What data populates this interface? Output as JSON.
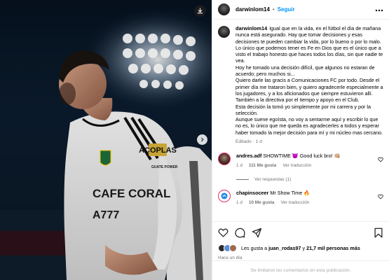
{
  "media": {
    "download_icon": "download-icon",
    "next_icon": "chevron-right-icon",
    "jersey": {
      "sponsor_top": "ACOPLAS",
      "sponsor_mid": "CAFE CORAL",
      "sponsor_low": "A777",
      "sleeve": "GUATE POWER"
    }
  },
  "header": {
    "username": "darwinlom14",
    "separator": "•",
    "follow_label": "Seguir",
    "more_icon": "more-horizontal-icon"
  },
  "caption": {
    "username": "darwinlom14",
    "text": "Igual que en la vida, en el fútbol el día de mañana nunca está asegurado. Hay que tomar decisiones y esas decisiones te pueden cambiar la vida, por lo bueno o por lo malo. Lo único que podemos tener es Fe en Dios que es el único que a visto el trabajo honesto que haces todos los días, sin que nadie te vea.\nHoy he tomado una decisión difícil, que algunos no estaran de acuerdo; pero muchos si...\nQuiero darle las gracis a Comunicaciones FC por todo. Desde el primer día me trataron bien, y quiero agradecerle especialmente a los jugadores, y a los aficionados que siempre estuvieron allí. También a la directiva por el tiempo y apoyo en el Club.\nEsta decisión la tomó yo simplemente por mi carrera y por la selección.\nAunque suene egoísta, no voy a sentarme aquí y escribir lo que no es, lo único que me queda es agradecerles a todos y esperar haber tomado la mejor decisión para mí y mi núcleo mas cercano.",
    "edited": "Editado · 1 d"
  },
  "comments": [
    {
      "username": "andres.adf",
      "text": "SHOWTIME 😈 Good luck bro! 👊🏼",
      "time": "1 d",
      "likes": "111 Me gusta",
      "reply": "Ver traducción",
      "replies": "Ver respuestas (1)"
    },
    {
      "username": "chapinsoceer",
      "text": "Mr Show Time 🔥",
      "time": "1 d",
      "likes": "10 Me gusta",
      "reply": "Ver traducción"
    }
  ],
  "actions": {
    "likes_prefix": "Les gusta a ",
    "likes_user": "juan_rodas97",
    "likes_mid": " y ",
    "likes_count": "21,7 mil personas más",
    "time": "Hace un día",
    "limited": "Se limitaron los comentarios en esta publicación."
  },
  "colors": {
    "follow": "#0095f6",
    "muted": "#737373"
  }
}
